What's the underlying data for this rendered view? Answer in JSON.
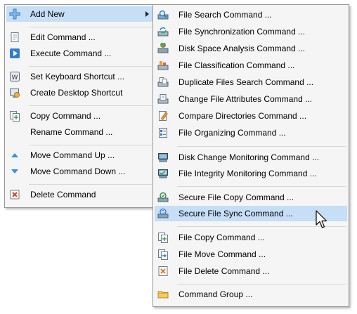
{
  "main_menu": {
    "items": [
      {
        "label": "Add New",
        "icon": "plus-icon"
      },
      {
        "label": "Edit Command ...",
        "icon": "edit-document-icon"
      },
      {
        "label": "Execute Command ...",
        "icon": "play-icon"
      },
      {
        "label": "Set Keyboard Shortcut ...",
        "icon": "keyboard-key-icon"
      },
      {
        "label": "Create Desktop Shortcut",
        "icon": "desktop-shortcut-icon"
      },
      {
        "label": "Copy Command ...",
        "icon": "copy-icon"
      },
      {
        "label": "Rename Command ...",
        "icon": ""
      },
      {
        "label": "Move Command Up ...",
        "icon": "triangle-up-icon"
      },
      {
        "label": "Move Command Down ...",
        "icon": "triangle-down-icon"
      },
      {
        "label": "Delete Command",
        "icon": "delete-icon"
      }
    ]
  },
  "sub_menu": {
    "items": [
      {
        "label": "File Search Command ...",
        "icon": "file-search-icon"
      },
      {
        "label": "File Synchronization Command ...",
        "icon": "file-sync-icon"
      },
      {
        "label": "Disk Space Analysis Command ...",
        "icon": "disk-space-icon"
      },
      {
        "label": "File Classification Command ...",
        "icon": "file-classification-icon"
      },
      {
        "label": "Duplicate Files Search Command ...",
        "icon": "duplicate-files-icon"
      },
      {
        "label": "Change File Attributes Command ...",
        "icon": "file-attributes-icon"
      },
      {
        "label": "Compare Directories Command ...",
        "icon": "compare-directories-icon"
      },
      {
        "label": "File Organizing Command ...",
        "icon": "file-organizing-icon"
      },
      {
        "label": "Disk Change Monitoring Command ...",
        "icon": "disk-monitor-icon"
      },
      {
        "label": "File Integrity Monitoring Command ...",
        "icon": "integrity-monitor-icon"
      },
      {
        "label": "Secure File Copy Command ...",
        "icon": "secure-copy-icon"
      },
      {
        "label": "Secure File Sync Command ...",
        "icon": "secure-sync-icon"
      },
      {
        "label": "File Copy Command ...",
        "icon": "file-copy-icon"
      },
      {
        "label": "File Move Command ...",
        "icon": "file-move-icon"
      },
      {
        "label": "File Delete Command ...",
        "icon": "file-delete-icon"
      },
      {
        "label": "Command Group ...",
        "icon": "folder-icon"
      }
    ]
  },
  "highlight_color": "#c6def6"
}
